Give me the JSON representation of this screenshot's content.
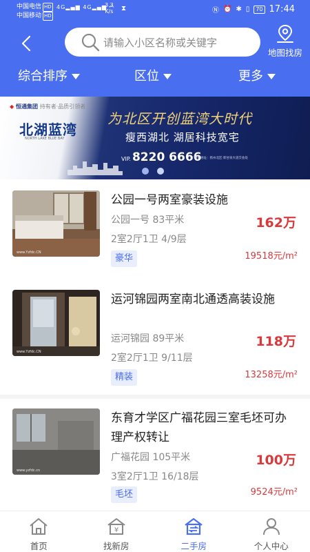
{
  "status_bar": {
    "carrier_1": "中国电信",
    "carrier_2": "中国移动",
    "hd": "HD",
    "net_1": "4G",
    "net_2": "4G",
    "speed_value": "3.3",
    "speed_unit": "K/s",
    "battery": "70",
    "time": "17:44"
  },
  "header": {
    "search_placeholder": "请输入小区名称或关键字",
    "map_search_label": "地图找房"
  },
  "filters": [
    {
      "label": "综合排序"
    },
    {
      "label": "区位"
    },
    {
      "label": "更多"
    }
  ],
  "banner": {
    "group_name": "恒通集团",
    "group_slogan": "持有者·品质引领者",
    "project_name": "北湖蓝湾",
    "project_subtitle": "NORTH LAKE BLUE BAY",
    "headline": "为北区开创蓝湾大时代",
    "tagline": "瘦西湖北  湖居科技宽宅",
    "vip_label": "VIP.",
    "phone": "8220 6666",
    "address": "项目地址：扬州北区·新甘泉大道交会处",
    "slides": 2,
    "active_slide": 1
  },
  "listings": [
    {
      "title": "公园一号两室豪装设施",
      "community_area": "公园一号 83平米",
      "layout_floor": "2室2厅1卫 4/9层",
      "tag": "豪华",
      "total_price": "162万",
      "unit_price": "19518元/m²",
      "watermark": "www.Yzfdc.CN"
    },
    {
      "title": "运河锦园两室南北通透高装设施",
      "community_area": "运河锦园 89平米",
      "layout_floor": "2室2厅1卫 9/11层",
      "tag": "精装",
      "total_price": "118万",
      "unit_price": "13258元/m²",
      "watermark": "www.Yzfdc.CN"
    },
    {
      "title": "东育才学区广福花园三室毛坯可办理产权转让",
      "community_area": "广福花园 105平米",
      "layout_floor": "3室2厅1卫 16/18层",
      "tag": "毛坯",
      "total_price": "100万",
      "unit_price": "9524元/m²",
      "watermark": "www.yzfdc.cn"
    }
  ],
  "bottom_nav": [
    {
      "label": "首页",
      "icon": "home-icon"
    },
    {
      "label": "找新房",
      "icon": "new-house-icon"
    },
    {
      "label": "二手房",
      "icon": "second-hand-house-icon",
      "active": true
    },
    {
      "label": "个人中心",
      "icon": "user-icon"
    }
  ],
  "colors": {
    "primary": "#4a6ef0",
    "price_red": "#d9393b",
    "tag_bg": "#e9eefc"
  }
}
